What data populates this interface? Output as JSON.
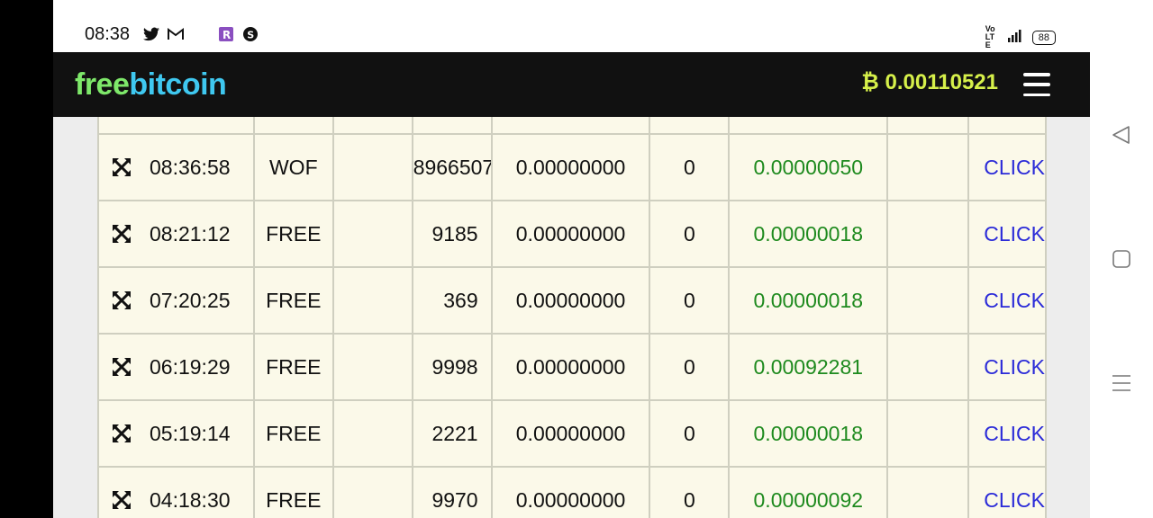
{
  "status_bar": {
    "time": "08:38",
    "left_icons": [
      "twitter-icon",
      "gmail-icon",
      "r-app-icon",
      "s-app-icon"
    ],
    "network": "Vo LTE",
    "lte": "LTE",
    "battery": "88"
  },
  "header": {
    "logo_free": "free",
    "logo_bitcoin": "bitcoin",
    "balance_symbol": "₿",
    "balance": "0.00110521",
    "menu_icon": "hamburger-menu-icon"
  },
  "rows": [
    {
      "time": "08:36:58",
      "type": "WOF",
      "col3": "",
      "number": "8966507",
      "col5": "0.00000000",
      "col6": "0",
      "reward": "0.00000050",
      "col8": "",
      "action": "CLICK"
    },
    {
      "time": "08:21:12",
      "type": "FREE",
      "col3": "",
      "number": "9185",
      "col5": "0.00000000",
      "col6": "0",
      "reward": "0.00000018",
      "col8": "",
      "action": "CLICK"
    },
    {
      "time": "07:20:25",
      "type": "FREE",
      "col3": "",
      "number": "369",
      "col5": "0.00000000",
      "col6": "0",
      "reward": "0.00000018",
      "col8": "",
      "action": "CLICK"
    },
    {
      "time": "06:19:29",
      "type": "FREE",
      "col3": "",
      "number": "9998",
      "col5": "0.00000000",
      "col6": "0",
      "reward": "0.00092281",
      "col8": "",
      "action": "CLICK"
    },
    {
      "time": "05:19:14",
      "type": "FREE",
      "col3": "",
      "number": "2221",
      "col5": "0.00000000",
      "col6": "0",
      "reward": "0.00000018",
      "col8": "",
      "action": "CLICK"
    },
    {
      "time": "04:18:30",
      "type": "FREE",
      "col3": "",
      "number": "9970",
      "col5": "0.00000000",
      "col6": "0",
      "reward": "0.00000092",
      "col8": "",
      "action": "CLICK"
    }
  ],
  "nav_buttons": [
    "back-icon",
    "home-icon",
    "recents-icon"
  ],
  "colors": {
    "logo_free": "#7ee86a",
    "logo_bitcoin": "#3fc8f0",
    "balance": "#d6f04a",
    "reward": "#1e8a1e",
    "link": "#2a2ad8",
    "row_bg": "#fbf9e9"
  }
}
